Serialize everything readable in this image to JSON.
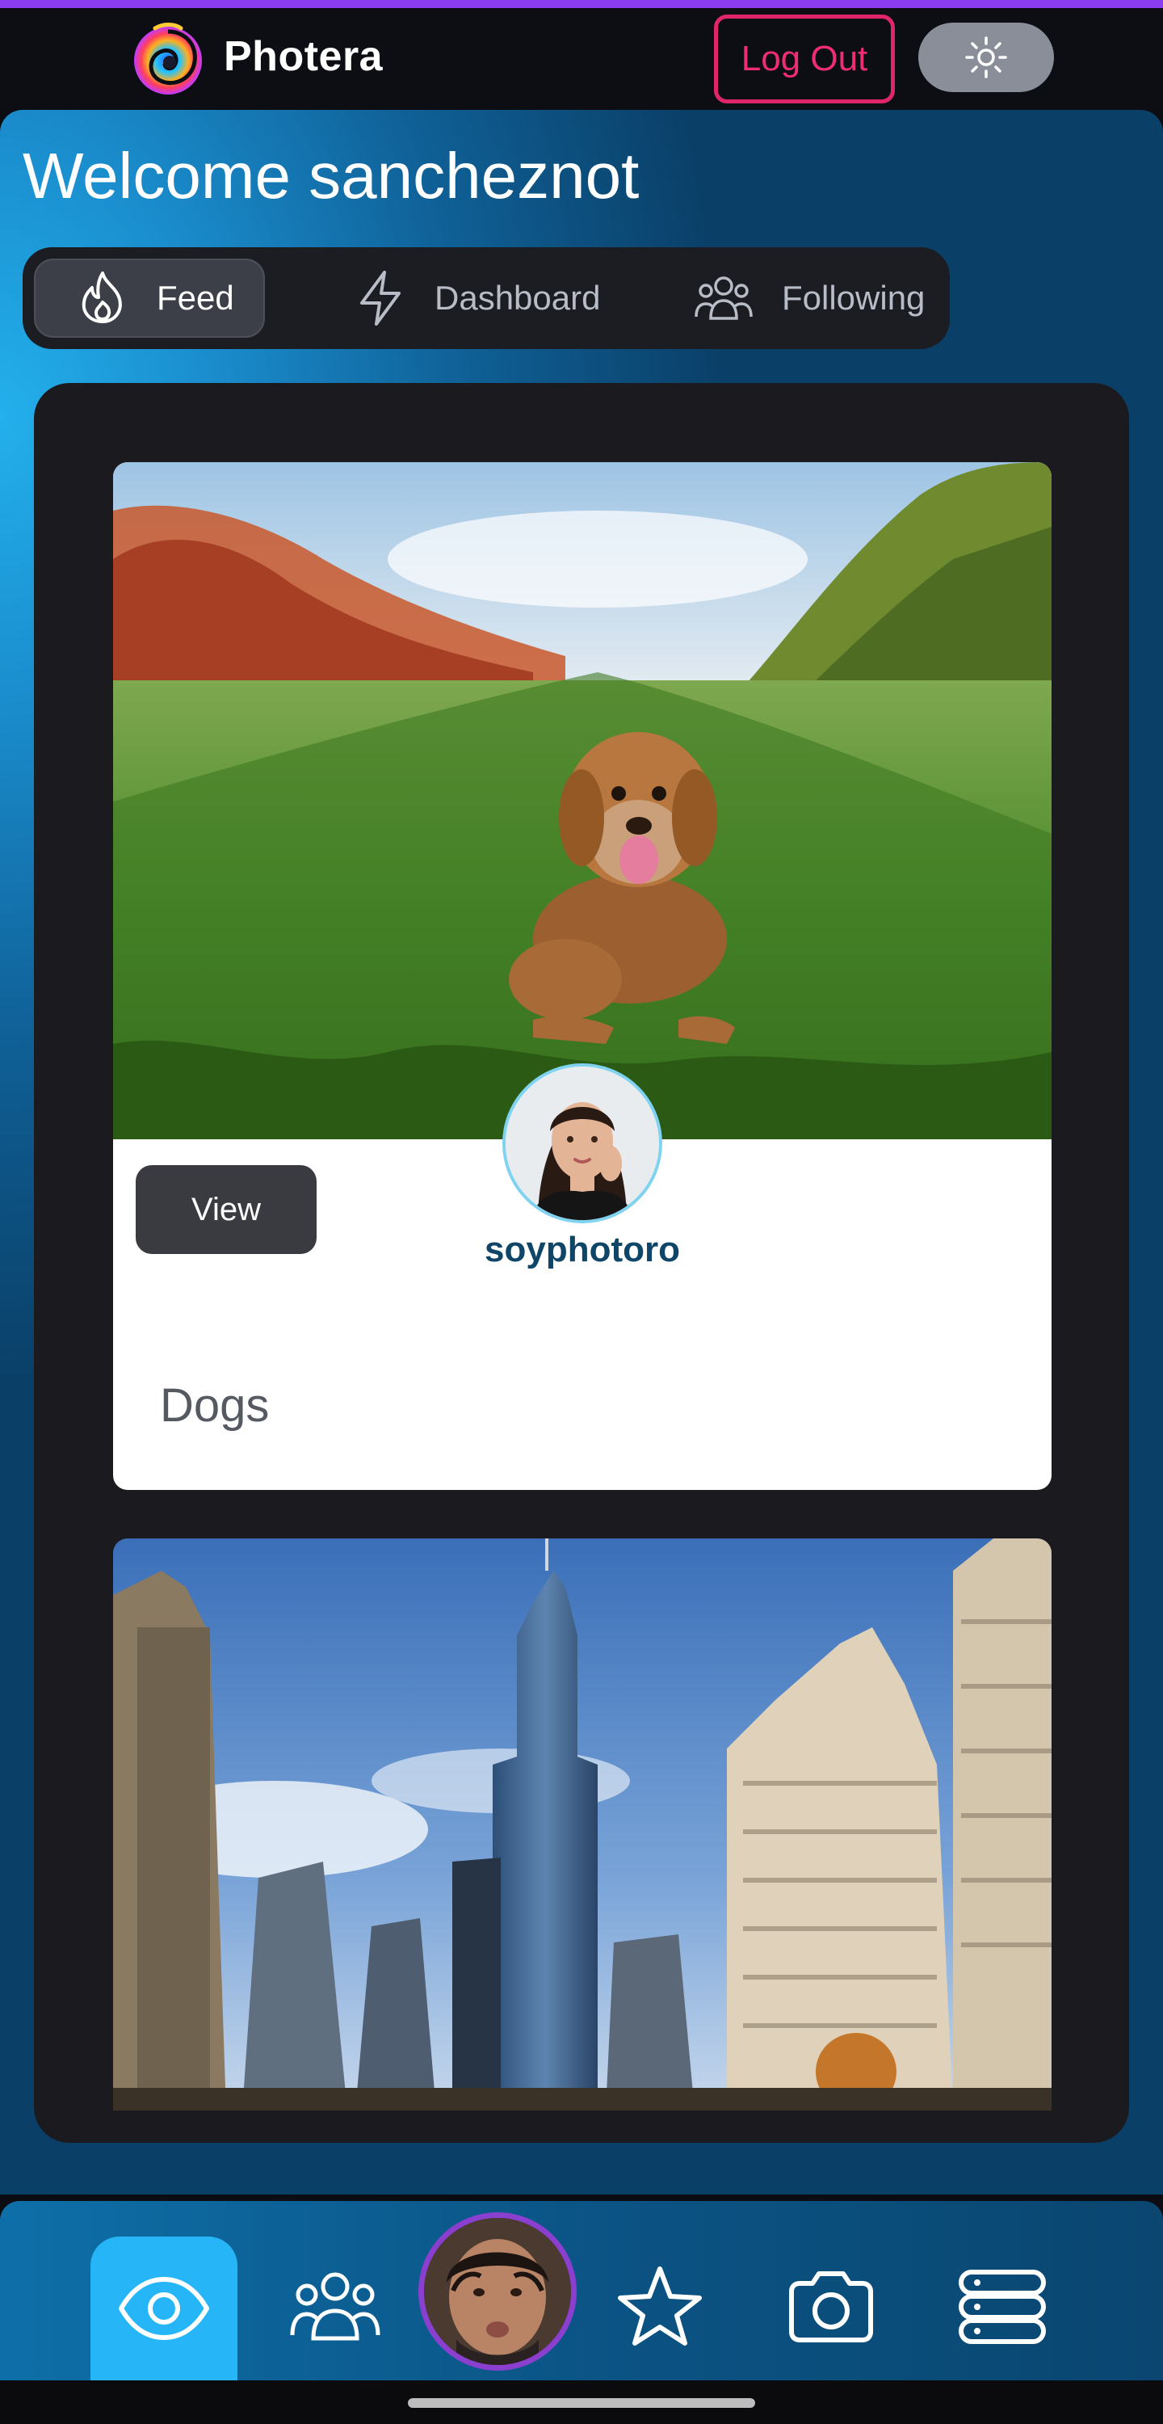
{
  "app": {
    "brand": "Photera",
    "logout_label": "Log Out"
  },
  "welcome": {
    "text": "Welcome sancheznot"
  },
  "tabs": [
    {
      "label": "Feed",
      "icon": "flame-icon",
      "active": true
    },
    {
      "label": "Dashboard",
      "icon": "lightning-icon",
      "active": false
    },
    {
      "label": "Following",
      "icon": "users-icon",
      "active": false
    }
  ],
  "posts": [
    {
      "image": "dog-in-grass-photo",
      "view_label": "View",
      "username": "soyphotoro",
      "caption": "Dogs"
    },
    {
      "image": "city-skyscrapers-photo"
    }
  ],
  "bottom_nav": [
    {
      "icon": "eye-icon",
      "active": true
    },
    {
      "icon": "users-icon",
      "active": false
    },
    {
      "icon": "user-avatar",
      "active": false
    },
    {
      "icon": "star-icon",
      "active": false
    },
    {
      "icon": "camera-icon",
      "active": false
    },
    {
      "icon": "server-icon",
      "active": false
    }
  ],
  "colors": {
    "accent": "#26b6f7",
    "logout": "#e0266b",
    "top_stripe": "#8b3cf0",
    "username": "#0f4566"
  }
}
